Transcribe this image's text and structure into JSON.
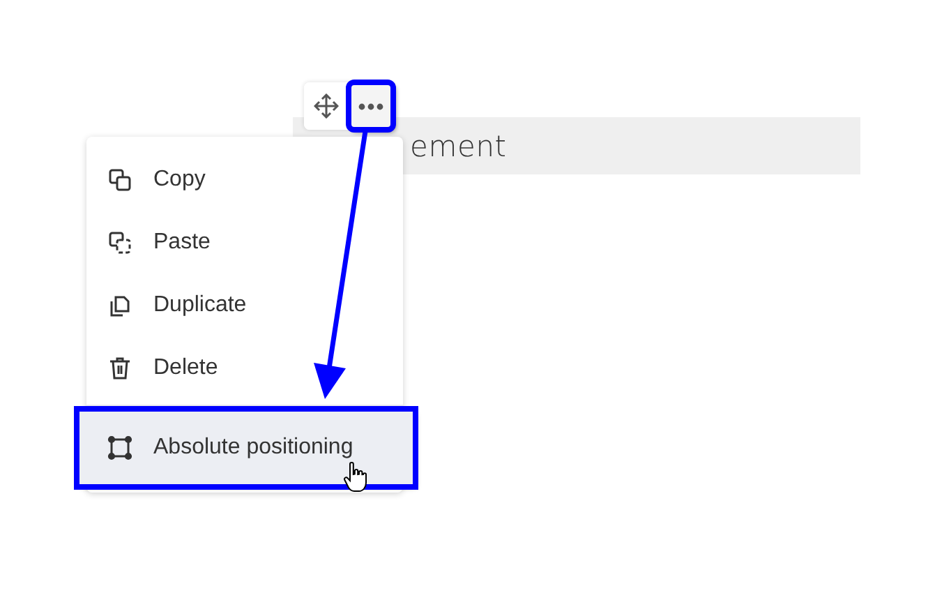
{
  "block": {
    "text": "ement"
  },
  "toolbar": [
    {
      "kind": "move",
      "marked": false
    },
    {
      "kind": "more",
      "marked": true
    }
  ],
  "menu": {
    "items": [
      {
        "kind": "copy",
        "label": "Copy",
        "selected": false,
        "marked": false
      },
      {
        "kind": "paste",
        "label": "Paste",
        "selected": false,
        "marked": false
      },
      {
        "kind": "duplicate",
        "label": "Duplicate",
        "selected": false,
        "marked": false
      },
      {
        "kind": "delete",
        "label": "Delete",
        "selected": false,
        "marked": false
      },
      {
        "kind": "frame",
        "label": "Absolute positioning",
        "selected": true,
        "marked": true
      }
    ]
  }
}
